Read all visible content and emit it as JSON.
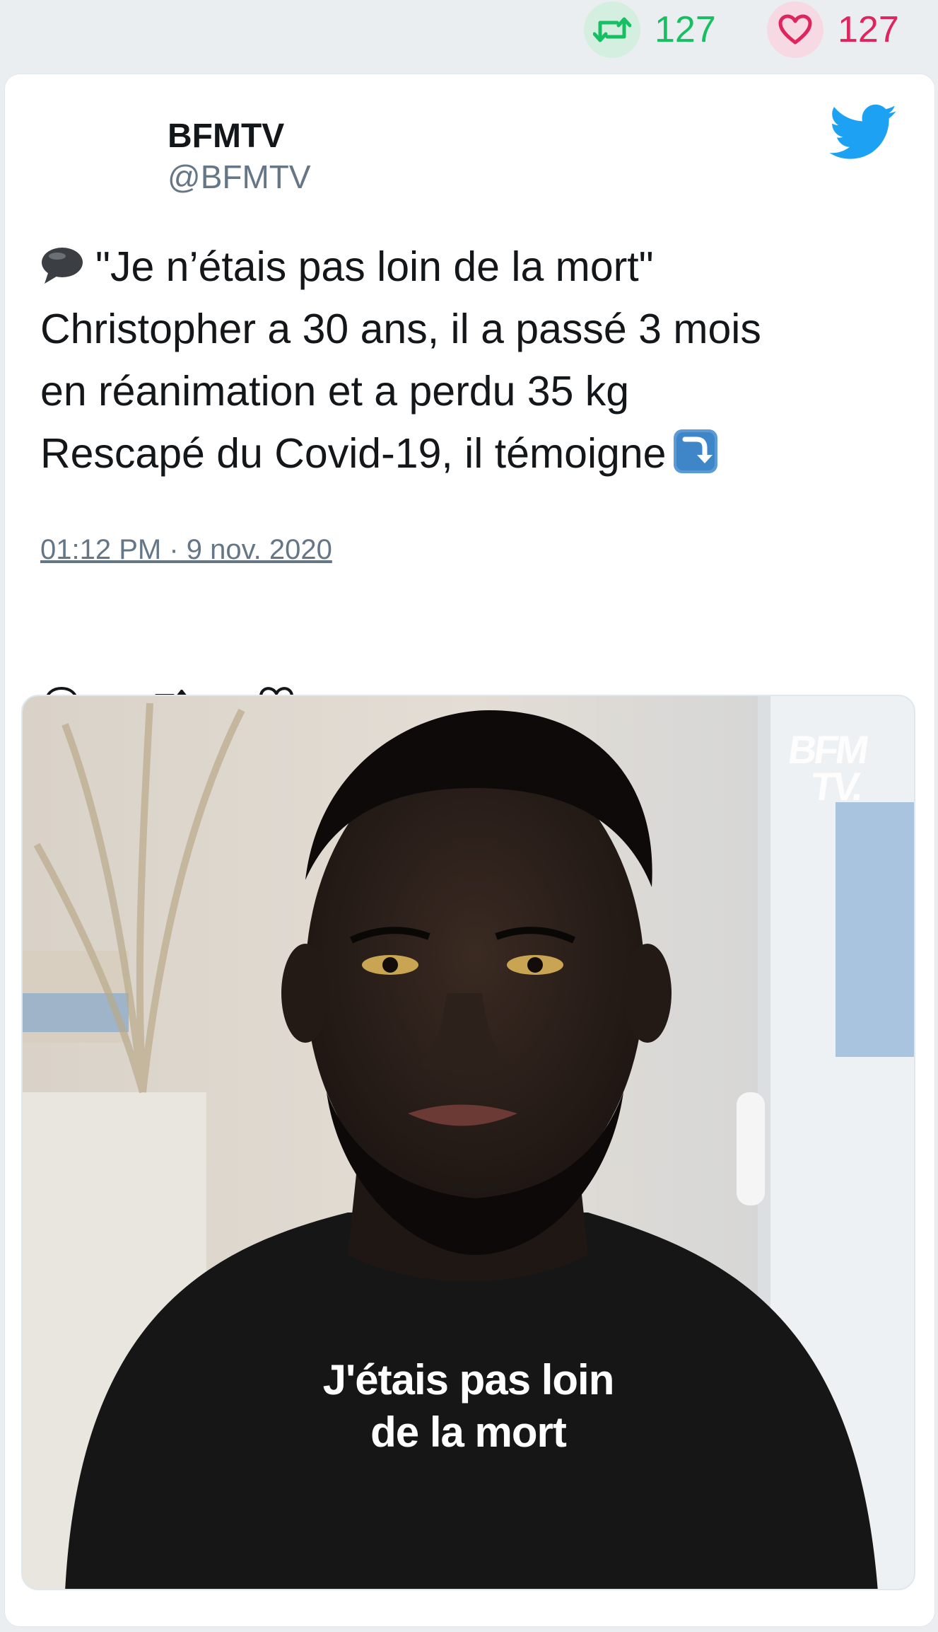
{
  "stats": {
    "retweets": "127",
    "likes": "127",
    "retweet_icon": "retweet-icon",
    "like_icon": "heart-icon",
    "retweet_color": "#17bf63",
    "like_color": "#e0245e"
  },
  "tweet": {
    "author_name": "BFMTV",
    "author_handle": "@BFMTV",
    "logo_icon": "twitter-bird-icon",
    "text_lines": [
      "\"Je n’étais pas loin de la mort\"",
      "Christopher a 30 ans, il a passé 3 mois",
      "en réanimation et a perdu 35 kg",
      "Rescapé du Covid-19, il témoigne"
    ],
    "leading_emoji": "speech-balloon-icon",
    "trailing_emoji": "arrow-down-right-icon",
    "timestamp": "01:12 PM · 9 nov. 2020",
    "actions": [
      "reply-icon",
      "retweet-icon",
      "like-icon"
    ]
  },
  "media": {
    "watermark_line1": "BFM",
    "watermark_line2": "TV.",
    "caption_line1": "J'étais pas loin",
    "caption_line2": "de la mort"
  }
}
